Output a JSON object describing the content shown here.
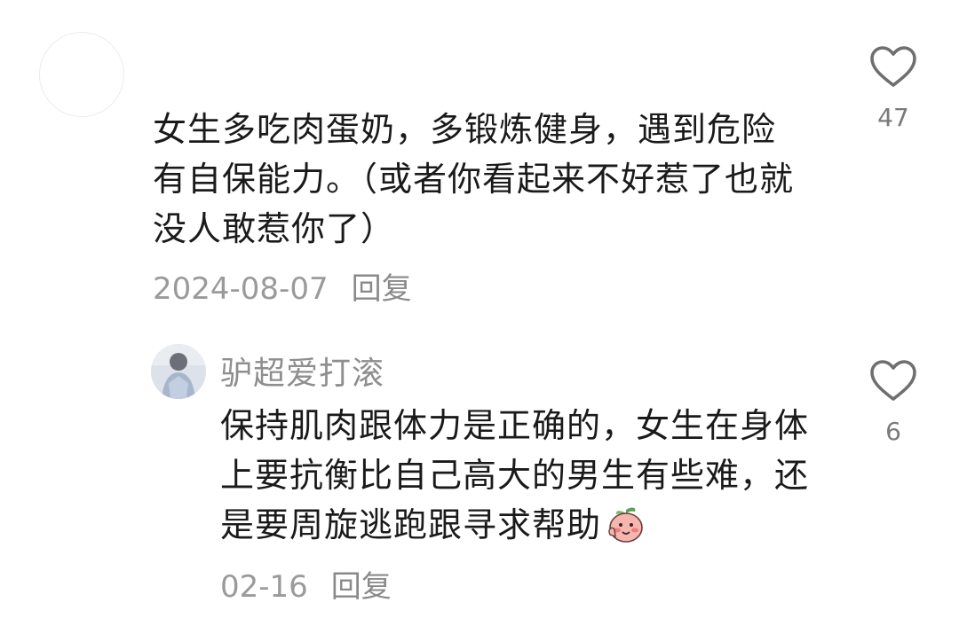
{
  "comment": {
    "text": "女生多吃肉蛋奶，多锻炼健身，遇到危险有自保能力。（或者你看起来不好惹了也就没人敢惹你了）",
    "date": "2024-08-07",
    "reply_label": "回复",
    "like_count": "47",
    "like_icon": "heart-outline-icon"
  },
  "reply": {
    "username": "驴超爱打滚",
    "text": "保持肌肉跟体力是正确的，女生在身体上要抗衡比自己高大的男生有些难，还是要周旋逃跑跟寻求帮助",
    "emoji": "peach-blush-emoji",
    "date": "02-16",
    "reply_label": "回复",
    "like_count": "6",
    "like_icon": "heart-outline-icon"
  },
  "colors": {
    "text": "#1a1a1a",
    "muted": "#9a9a9a",
    "icon": "#6f6f6f"
  }
}
